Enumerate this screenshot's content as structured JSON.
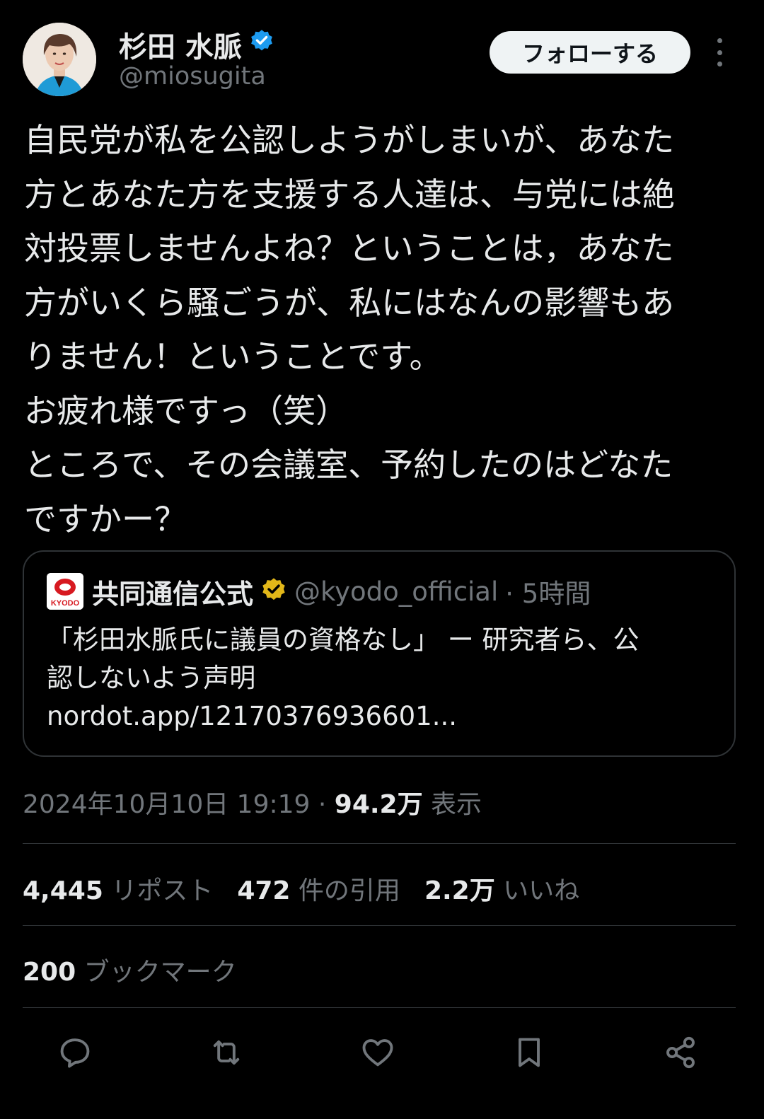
{
  "author": {
    "display_name": "杉田 水脈",
    "handle": "@miosugita",
    "verified_color": "#1d9bf0"
  },
  "follow_button": {
    "label": "フォローする"
  },
  "tweet": {
    "lines": [
      "自民党が私を公認しようがしまいが、あなた",
      "方とあなた方を支援する人達は、与党には絶",
      "対投票しませんよね？ということは，あなた",
      "方がいくら騒ごうが、私にはなんの影響もあ",
      "りません！ということです。",
      "お疲れ様ですっ（笑）",
      "ところで、その会議室、予約したのはどなた",
      "ですかー？"
    ]
  },
  "quote": {
    "name": "共同通信公式",
    "handle": "@kyodo_official",
    "time": "· 5時間",
    "verified_color": "#e2b719",
    "lines": [
      "「杉田水脈氏に議員の資格なし」 ー 研究者ら、公",
      "認しないよう声明",
      "nordot.app/12170376936601..."
    ],
    "logo_text": "KYODO"
  },
  "meta": {
    "datetime": "2024年10月10日 19:19",
    "separator": " · ",
    "views": "94.2万",
    "views_label": " 表示"
  },
  "stats": {
    "reposts": "4,445",
    "reposts_label": " リポスト",
    "quotes": "472",
    "quotes_label": " 件の引用",
    "likes": "2.2万",
    "likes_label": " いいね",
    "bookmarks": "200",
    "bookmarks_label": " ブックマーク"
  },
  "actions": [
    "reply-icon",
    "repost-icon",
    "like-icon",
    "bookmark-icon",
    "share-icon"
  ],
  "colors": {
    "background": "#000000",
    "text": "#e7e9ea",
    "secondary": "#71767b",
    "border": "#2f3336"
  }
}
